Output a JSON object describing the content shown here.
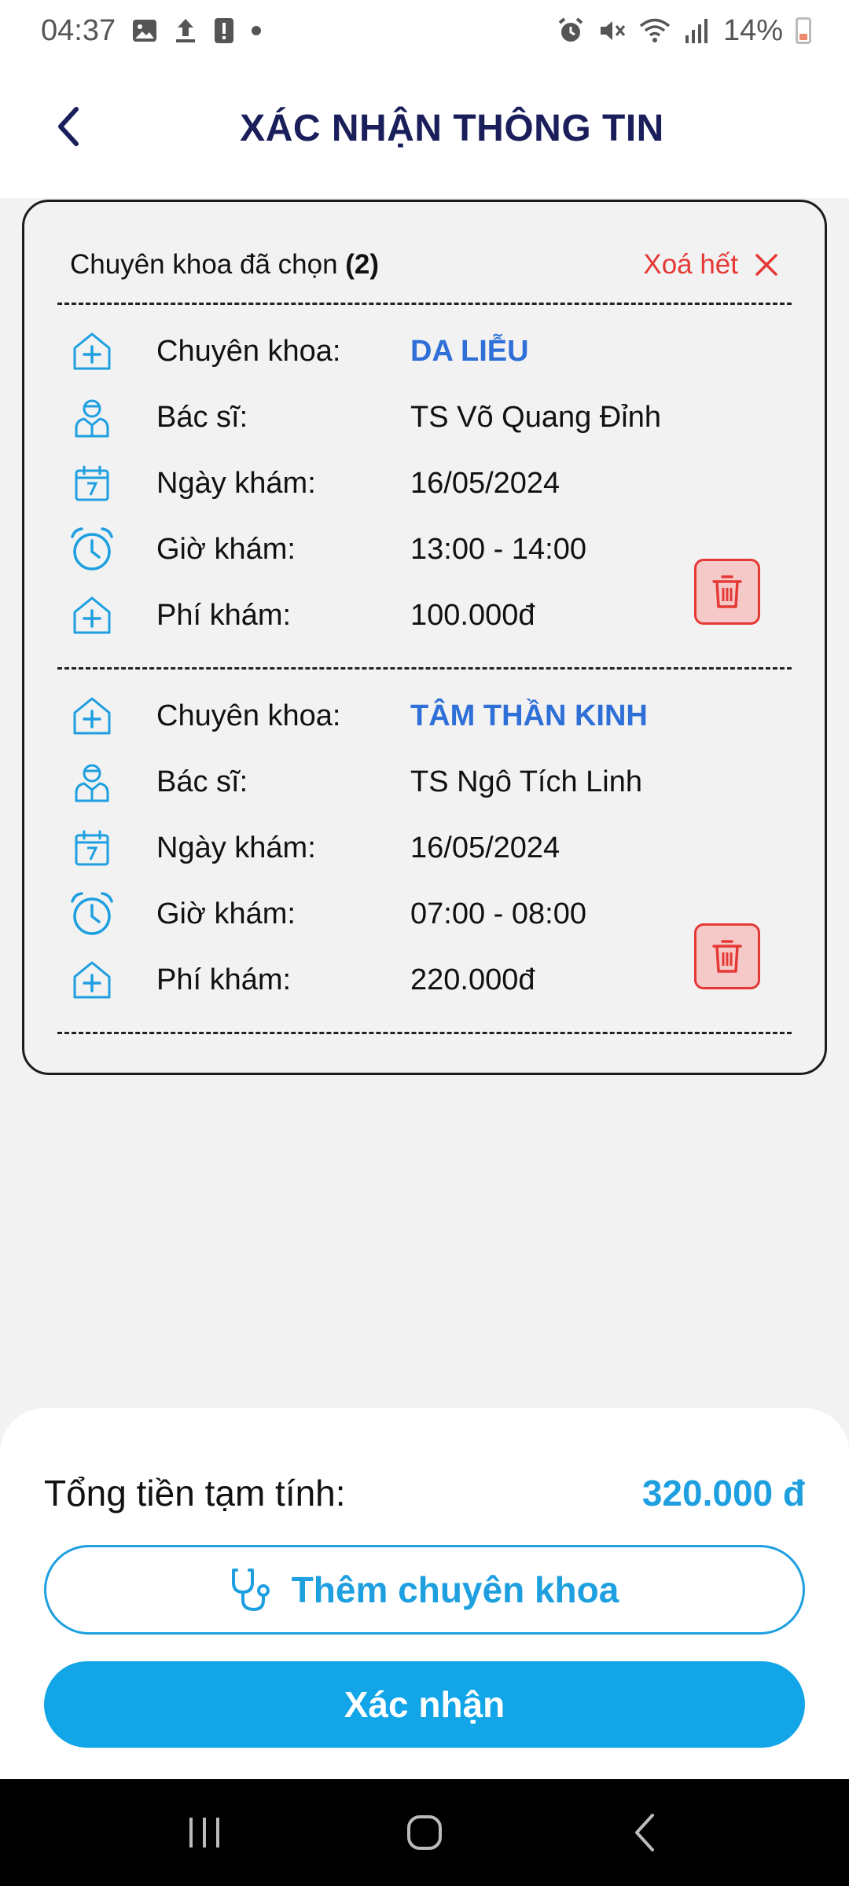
{
  "status_bar": {
    "time": "04:37",
    "battery": "14%",
    "left_icons": [
      "image-icon",
      "upload-icon",
      "alert-icon",
      "dot-icon"
    ],
    "right_icons": [
      "alarm-icon",
      "mute-icon",
      "wifi-icon",
      "signal-icon",
      "battery-icon"
    ]
  },
  "header": {
    "title": "XÁC NHẬN THÔNG TIN",
    "back_icon": "chevron-left-icon"
  },
  "selected": {
    "title": "Chuyên khoa đã chọn",
    "count": "(2)",
    "clear_label": "Xoá hết",
    "clear_icon": "close-icon"
  },
  "labels": {
    "specialty": "Chuyên khoa:",
    "doctor": "Bác sĩ:",
    "date": "Ngày khám:",
    "time": "Giờ khám:",
    "fee": "Phí khám:"
  },
  "entries": [
    {
      "specialty": "DA LIỄU",
      "doctor": "TS Võ Quang Đỉnh",
      "date": "16/05/2024",
      "time": "13:00 - 14:00",
      "fee": "100.000đ"
    },
    {
      "specialty": "TÂM THẦN KINH",
      "doctor": "TS Ngô Tích Linh",
      "date": "16/05/2024",
      "time": "07:00 - 08:00",
      "fee": "220.000đ"
    }
  ],
  "summary": {
    "total_label": "Tổng tiền tạm tính:",
    "total_value": "320.000 đ"
  },
  "buttons": {
    "add_specialty": "Thêm chuyên khoa",
    "confirm": "Xác nhận"
  },
  "colors": {
    "accent": "#1d9fe0",
    "title": "#1a1f5c",
    "specialty": "#2f6fd8",
    "danger": "#e53935"
  }
}
